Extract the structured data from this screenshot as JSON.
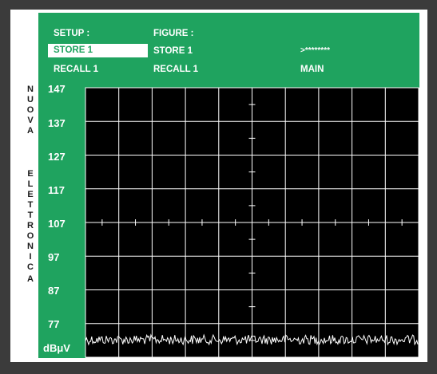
{
  "menu": {
    "setup_label": "SETUP :",
    "figure_label": "FIGURE :",
    "setup_store": "STORE 1",
    "figure_store": "STORE 1",
    "password": ">********",
    "setup_recall": "RECALL 1",
    "figure_recall": "RECALL 1",
    "main": "MAIN"
  },
  "brand_letters": [
    "N",
    "U",
    "O",
    "V",
    "A",
    "E",
    "L",
    "E",
    "T",
    "T",
    "R",
    "O",
    "N",
    "I",
    "C",
    "A"
  ],
  "scale": {
    "labels": [
      "147",
      "137",
      "127",
      "117",
      "107",
      "97",
      "87",
      "77"
    ],
    "unit": "dBμV"
  },
  "colors": {
    "background": "#3b3b3b",
    "accent_green": "#1fa35f",
    "plot_black": "#000000",
    "grid": "#ffffff"
  }
}
